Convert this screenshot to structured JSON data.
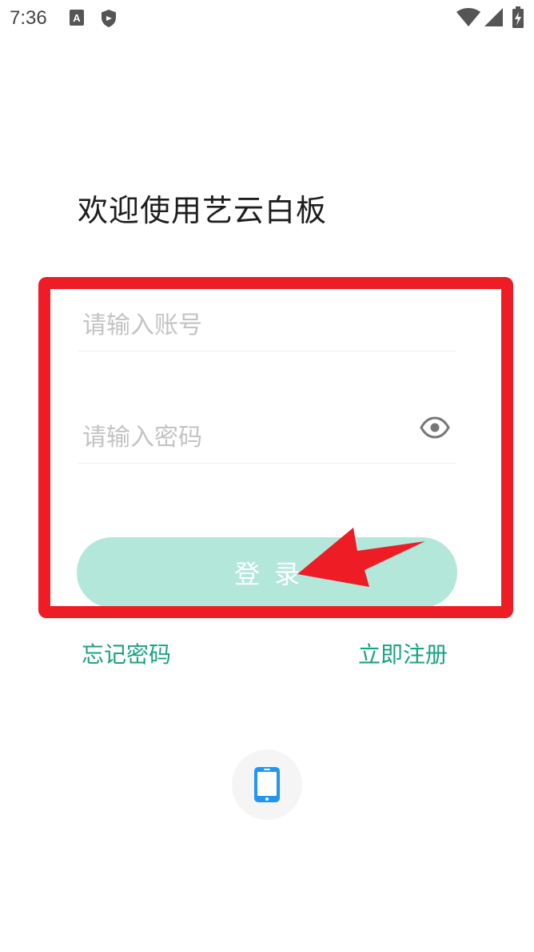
{
  "status_bar": {
    "time": "7:36",
    "icons": [
      "a-notification-icon",
      "shield-icon",
      "wifi-icon",
      "signal-icon",
      "battery-charging-icon"
    ]
  },
  "welcome": {
    "title": "欢迎使用艺云白板"
  },
  "form": {
    "account_placeholder": "请输入账号",
    "password_placeholder": "请输入密码",
    "login_label": "登录",
    "forgot_password_label": "忘记密码",
    "register_label": "立即注册"
  },
  "other_login": {
    "phone_icon": "phone-icon"
  },
  "colors": {
    "accent": "#19a383",
    "login_button": "#b3e7da",
    "annotation": "#ee1c25",
    "phone_icon": "#2196f3"
  }
}
